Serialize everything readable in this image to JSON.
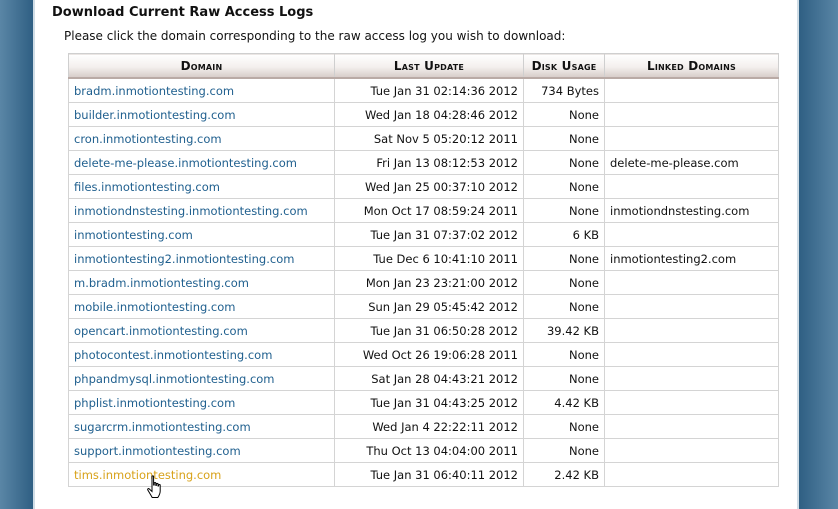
{
  "section_title": "Download Current Raw Access Logs",
  "instructions": "Please click the domain corresponding to the raw access log you wish to download:",
  "table": {
    "headers": {
      "domain": "Domain",
      "last_update": "Last Update",
      "disk_usage": "Disk Usage",
      "linked_domains": "Linked Domains"
    },
    "rows": [
      {
        "domain": "bradm.inmotiontesting.com",
        "last_update": "Tue Jan 31 02:14:36 2012",
        "disk_usage": "734 Bytes",
        "linked": ""
      },
      {
        "domain": "builder.inmotiontesting.com",
        "last_update": "Wed Jan 18 04:28:46 2012",
        "disk_usage": "None",
        "linked": ""
      },
      {
        "domain": "cron.inmotiontesting.com",
        "last_update": "Sat Nov 5 05:20:12 2011",
        "disk_usage": "None",
        "linked": ""
      },
      {
        "domain": "delete-me-please.inmotiontesting.com",
        "last_update": "Fri Jan 13 08:12:53 2012",
        "disk_usage": "None",
        "linked": "delete-me-please.com"
      },
      {
        "domain": "files.inmotiontesting.com",
        "last_update": "Wed Jan 25 00:37:10 2012",
        "disk_usage": "None",
        "linked": ""
      },
      {
        "domain": "inmotiondnstesting.inmotiontesting.com",
        "last_update": "Mon Oct 17 08:59:24 2011",
        "disk_usage": "None",
        "linked": "inmotiondnstesting.com"
      },
      {
        "domain": "inmotiontesting.com",
        "last_update": "Tue Jan 31 07:37:02 2012",
        "disk_usage": "6 KB",
        "linked": ""
      },
      {
        "domain": "inmotiontesting2.inmotiontesting.com",
        "last_update": "Tue Dec 6 10:41:10 2011",
        "disk_usage": "None",
        "linked": "inmotiontesting2.com"
      },
      {
        "domain": "m.bradm.inmotiontesting.com",
        "last_update": "Mon Jan 23 23:21:00 2012",
        "disk_usage": "None",
        "linked": ""
      },
      {
        "domain": "mobile.inmotiontesting.com",
        "last_update": "Sun Jan 29 05:45:42 2012",
        "disk_usage": "None",
        "linked": ""
      },
      {
        "domain": "opencart.inmotiontesting.com",
        "last_update": "Tue Jan 31 06:50:28 2012",
        "disk_usage": "39.42 KB",
        "linked": ""
      },
      {
        "domain": "photocontest.inmotiontesting.com",
        "last_update": "Wed Oct 26 19:06:28 2011",
        "disk_usage": "None",
        "linked": ""
      },
      {
        "domain": "phpandmysql.inmotiontesting.com",
        "last_update": "Sat Jan 28 04:43:21 2012",
        "disk_usage": "None",
        "linked": ""
      },
      {
        "domain": "phplist.inmotiontesting.com",
        "last_update": "Tue Jan 31 04:43:25 2012",
        "disk_usage": "4.42 KB",
        "linked": ""
      },
      {
        "domain": "sugarcrm.inmotiontesting.com",
        "last_update": "Wed Jan 4 22:22:11 2012",
        "disk_usage": "None",
        "linked": ""
      },
      {
        "domain": "support.inmotiontesting.com",
        "last_update": "Thu Oct 13 04:04:00 2011",
        "disk_usage": "None",
        "linked": ""
      },
      {
        "domain": "tims.inmotiontesting.com",
        "last_update": "Tue Jan 31 06:40:11 2012",
        "disk_usage": "2.42 KB",
        "linked": "",
        "hovered": true
      }
    ]
  },
  "colors": {
    "link": "#1f5f8e",
    "link_hover": "#d8a21a",
    "side_background": "#2f5f83"
  },
  "cursor_icon": "hand-pointer-icon"
}
